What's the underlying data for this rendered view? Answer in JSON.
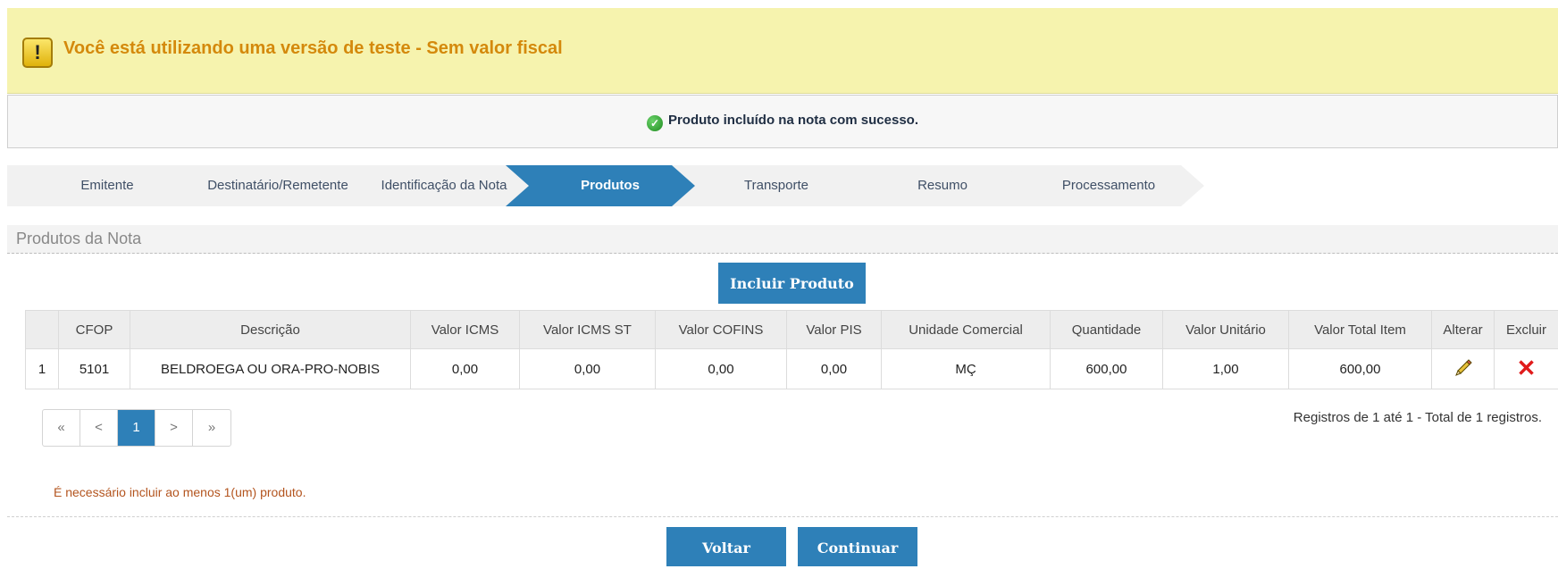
{
  "banner": {
    "warning_text": "Você está utilizando uma versão de teste - Sem valor fiscal",
    "icon": "exclamation-icon"
  },
  "notification": {
    "text": "Produto incluído na nota com sucesso.",
    "icon": "check-circle-icon"
  },
  "steps": [
    {
      "label": "Emitente",
      "active": false
    },
    {
      "label": "Destinatário/Remetente",
      "active": false
    },
    {
      "label": "Identificação da Nota",
      "active": false
    },
    {
      "label": "Produtos",
      "active": true
    },
    {
      "label": "Transporte",
      "active": false
    },
    {
      "label": "Resumo",
      "active": false
    },
    {
      "label": "Processamento",
      "active": false
    }
  ],
  "section": {
    "title": "Produtos da Nota"
  },
  "buttons": {
    "incluir": "Incluir Produto",
    "voltar": "Voltar",
    "continuar": "Continuar"
  },
  "table": {
    "headers": [
      "",
      "CFOP",
      "Descrição",
      "Valor ICMS",
      "Valor ICMS ST",
      "Valor COFINS",
      "Valor PIS",
      "Unidade Comercial",
      "Quantidade",
      "Valor Unitário",
      "Valor Total Item",
      "Alterar",
      "Excluir"
    ],
    "rows": [
      {
        "num": "1",
        "cfop": "5101",
        "descricao": "BELDROEGA OU ORA-PRO-NOBIS",
        "icms": "0,00",
        "icms_st": "0,00",
        "cofins": "0,00",
        "pis": "0,00",
        "unidade": "MÇ",
        "quantidade": "600,00",
        "unitario": "1,00",
        "total": "600,00"
      }
    ]
  },
  "pagination": {
    "first": "«",
    "prev": "<",
    "current": "1",
    "next": ">",
    "last": "»"
  },
  "records_text": "Registros de 1 até 1 - Total de 1 registros.",
  "error_text": "É necessário incluir ao menos 1(um) produto."
}
